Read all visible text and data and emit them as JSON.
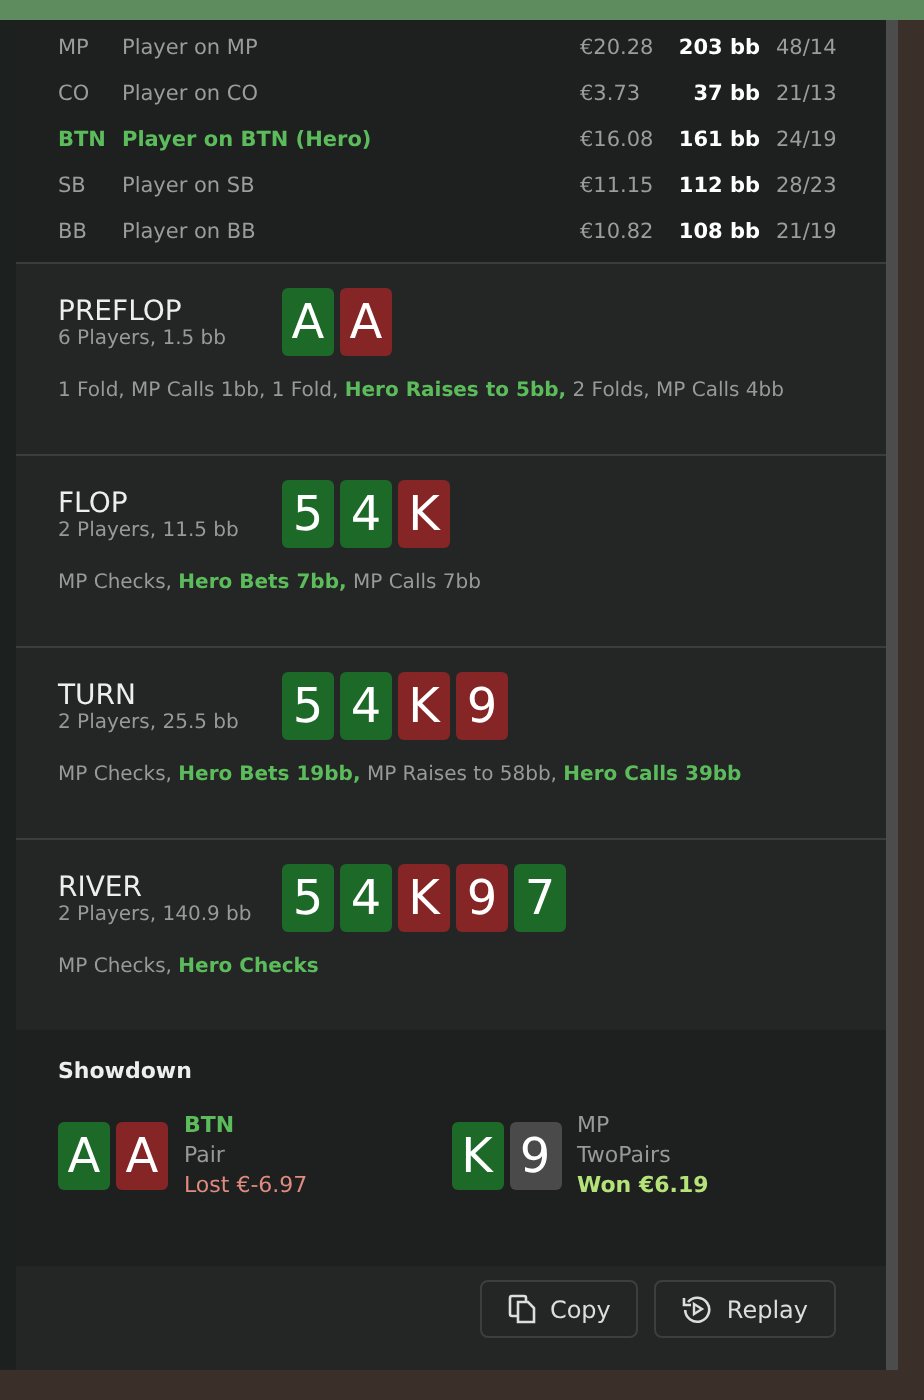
{
  "players": [
    {
      "position": "MP",
      "name": "Player on MP",
      "stack": "€20.28",
      "bb": "203 bb",
      "stats": "48/14",
      "hero": false
    },
    {
      "position": "CO",
      "name": "Player on CO",
      "stack": "€3.73",
      "bb": "37 bb",
      "stats": "21/13",
      "hero": false
    },
    {
      "position": "BTN",
      "name": "Player on BTN (Hero)",
      "stack": "€16.08",
      "bb": "161 bb",
      "stats": "24/19",
      "hero": true
    },
    {
      "position": "SB",
      "name": "Player on SB",
      "stack": "€11.15",
      "bb": "112 bb",
      "stats": "28/23",
      "hero": false
    },
    {
      "position": "BB",
      "name": "Player on BB",
      "stack": "€10.82",
      "bb": "108 bb",
      "stats": "21/19",
      "hero": false
    }
  ],
  "streets": [
    {
      "name": "PREFLOP",
      "info": "6 Players, 1.5 bb",
      "cards": [
        {
          "rank": "A",
          "color": "#1d6a28"
        },
        {
          "rank": "A",
          "color": "#862525"
        }
      ],
      "actions": [
        {
          "text": "1 Fold, MP Calls 1bb, 1 Fold, ",
          "hero": false
        },
        {
          "text": "Hero Raises to 5bb,",
          "hero": true
        },
        {
          "text": " 2 Folds, MP Calls 4bb",
          "hero": false
        }
      ]
    },
    {
      "name": "FLOP",
      "info": "2 Players, 11.5 bb",
      "cards": [
        {
          "rank": "5",
          "color": "#1d6a28"
        },
        {
          "rank": "4",
          "color": "#1d6a28"
        },
        {
          "rank": "K",
          "color": "#862525"
        }
      ],
      "actions": [
        {
          "text": "MP Checks, ",
          "hero": false
        },
        {
          "text": "Hero Bets 7bb,",
          "hero": true
        },
        {
          "text": " MP Calls 7bb",
          "hero": false
        }
      ]
    },
    {
      "name": "TURN",
      "info": "2 Players, 25.5 bb",
      "cards": [
        {
          "rank": "5",
          "color": "#1d6a28"
        },
        {
          "rank": "4",
          "color": "#1d6a28"
        },
        {
          "rank": "K",
          "color": "#862525"
        },
        {
          "rank": "9",
          "color": "#862525"
        }
      ],
      "actions": [
        {
          "text": "MP Checks, ",
          "hero": false
        },
        {
          "text": "Hero Bets 19bb,",
          "hero": true
        },
        {
          "text": " MP Raises to 58bb, ",
          "hero": false
        },
        {
          "text": "Hero Calls 39bb",
          "hero": true
        }
      ]
    },
    {
      "name": "RIVER",
      "info": "2 Players, 140.9 bb",
      "cards": [
        {
          "rank": "5",
          "color": "#1d6a28"
        },
        {
          "rank": "4",
          "color": "#1d6a28"
        },
        {
          "rank": "K",
          "color": "#862525"
        },
        {
          "rank": "9",
          "color": "#862525"
        },
        {
          "rank": "7",
          "color": "#1d6a28"
        }
      ],
      "actions": [
        {
          "text": "MP Checks, ",
          "hero": false
        },
        {
          "text": "Hero Checks",
          "hero": true
        }
      ]
    }
  ],
  "showdown": {
    "title": "Showdown",
    "hands": [
      {
        "position": "BTN",
        "hero": true,
        "cards": [
          {
            "rank": "A",
            "color": "#1d6a28"
          },
          {
            "rank": "A",
            "color": "#862525"
          }
        ],
        "hand": "Pair",
        "result": "Lost €-6.97",
        "won": false
      },
      {
        "position": "MP",
        "hero": false,
        "cards": [
          {
            "rank": "K",
            "color": "#1d6a28"
          },
          {
            "rank": "9",
            "color": "#4a4a4a"
          }
        ],
        "hand": "TwoPairs",
        "result": "Won €6.19",
        "won": true
      }
    ]
  },
  "buttons": [
    {
      "label": "Copy",
      "kind": "copy"
    },
    {
      "label": "Replay",
      "kind": "replay"
    }
  ]
}
